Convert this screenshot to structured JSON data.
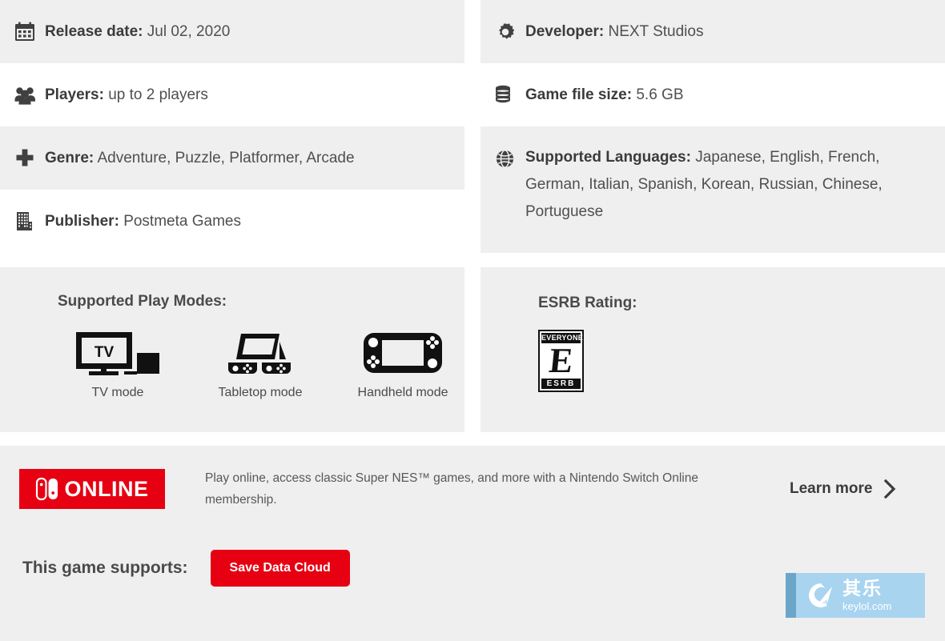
{
  "specs": {
    "left": [
      {
        "icon": "calendar-icon",
        "key": "Release date:",
        "value": "Jul 02, 2020",
        "name": "release-date"
      },
      {
        "icon": "players-icon",
        "key": "Players:",
        "value": "up to 2 players",
        "name": "players"
      },
      {
        "icon": "genre-icon",
        "key": "Genre:",
        "value": "Adventure, Puzzle, Platformer, Arcade",
        "name": "genre"
      },
      {
        "icon": "building-icon",
        "key": "Publisher:",
        "value": "Postmeta Games",
        "name": "publisher"
      }
    ],
    "right": [
      {
        "icon": "gear-icon",
        "key": "Developer:",
        "value": "NEXT Studios",
        "name": "developer"
      },
      {
        "icon": "database-icon",
        "key": "Game file size:",
        "value": "5.6 GB",
        "name": "game-file-size"
      },
      {
        "icon": "globe-icon",
        "key": "Supported Languages:",
        "value": "Japanese, English, French, German, Italian, Spanish, Korean, Russian, Chinese, Portuguese",
        "name": "supported-languages"
      }
    ]
  },
  "play_modes": {
    "title": "Supported Play Modes:",
    "modes": [
      {
        "icon": "tv-mode-icon",
        "label": "TV mode"
      },
      {
        "icon": "tabletop-mode-icon",
        "label": "Tabletop mode"
      },
      {
        "icon": "handheld-mode-icon",
        "label": "Handheld mode"
      }
    ]
  },
  "esrb": {
    "title": "ESRB Rating:",
    "badge_top": "EVERYONE",
    "badge_letter": "E",
    "badge_bottom": "ESRB"
  },
  "nso_banner": {
    "logo_word": "ONLINE",
    "logo_icon": "switch-controller-icon",
    "description": "Play online, access classic Super NES™ games, and more with a Nintendo Switch Online membership.",
    "learn_more": "Learn more",
    "learn_more_icon": "chevron-right-icon"
  },
  "supports": {
    "label": "This game supports:",
    "feature": "Save Data Cloud"
  },
  "watermark": {
    "logo_icon": "keylol-logo-icon",
    "cn_text": "其乐",
    "url_text": "keylol.com"
  },
  "colors": {
    "shade": "#efefef",
    "white": "#ffffff",
    "text": "#4a4a4a",
    "nintendo_red": "#e60012",
    "watermark_blue": "#a8d4f0"
  }
}
